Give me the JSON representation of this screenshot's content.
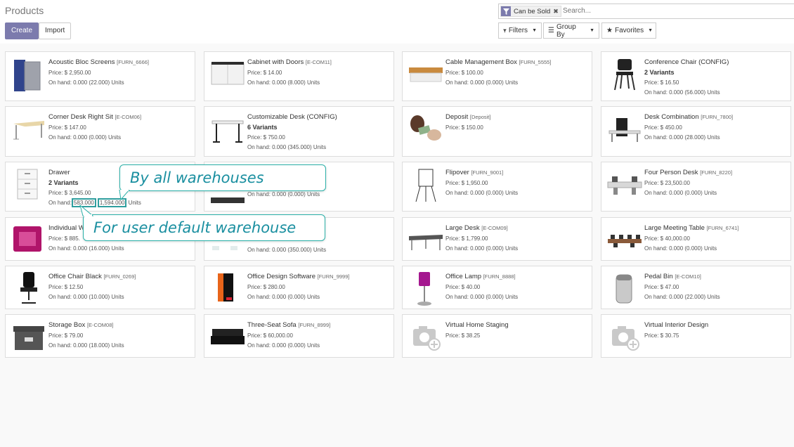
{
  "header": {
    "title": "Products",
    "create_label": "Create",
    "import_label": "Import"
  },
  "search": {
    "facet_value": "Can be Sold",
    "placeholder": "Search...",
    "filters_label": "Filters",
    "groupby_label": "Group By",
    "favorites_label": "Favorites"
  },
  "products": [
    {
      "name": "Acoustic Bloc Screens",
      "ref": "[FURN_6666]",
      "variants": "",
      "price": "Price: $ 2,950.00",
      "onhand": "On hand: 0.000 (22.000) Units",
      "icon": "acoustic-screen-icon"
    },
    {
      "name": "Cabinet with Doors",
      "ref": "[E-COM11]",
      "variants": "",
      "price": "Price: $ 14.00",
      "onhand": "On hand: 0.000 (8.000) Units",
      "icon": "cabinet-icon"
    },
    {
      "name": "Cable Management Box",
      "ref": "[FURN_5555]",
      "variants": "",
      "price": "Price: $ 100.00",
      "onhand": "On hand: 0.000 (0.000) Units",
      "icon": "cable-box-icon"
    },
    {
      "name": "Conference Chair (CONFIG)",
      "ref": "",
      "variants": "2 Variants",
      "price": "Price: $ 16.50",
      "onhand": "On hand: 0.000 (56.000) Units",
      "icon": "chair-icon"
    },
    {
      "name": "Corner Desk Right Sit",
      "ref": "[E-COM06]",
      "variants": "",
      "price": "Price: $ 147.00",
      "onhand": "On hand: 0.000 (0.000) Units",
      "icon": "corner-desk-icon"
    },
    {
      "name": "Customizable Desk (CONFIG)",
      "ref": "",
      "variants": "6 Variants",
      "price": "Price: $ 750.00",
      "onhand": "On hand: 0.000 (345.000) Units",
      "icon": "desk-icon"
    },
    {
      "name": "Deposit",
      "ref": "[Deposit]",
      "variants": "",
      "price": "Price: $ 150.00",
      "onhand": "",
      "icon": "money-icon"
    },
    {
      "name": "Desk Combination",
      "ref": "[FURN_7800]",
      "variants": "",
      "price": "Price: $ 450.00",
      "onhand": "On hand: 0.000 (28.000) Units",
      "icon": "desk-combination-icon"
    },
    {
      "name": "Drawer",
      "ref": "",
      "variants": "2 Variants",
      "price": "Price: $ 3,645.00",
      "onhand_prefix": "On hand:",
      "onhand_default": "583.000",
      "onhand_all": "1,594.000",
      "onhand_suffix": "Units",
      "icon": "drawer-icon"
    },
    {
      "name": "",
      "ref": "",
      "variants": "",
      "price": "",
      "onhand": "On hand: 0.000 (0.000) Units",
      "icon": "hidden-product-icon"
    },
    {
      "name": "Flipover",
      "ref": "[FURN_9001]",
      "variants": "",
      "price": "Price: $ 1,950.00",
      "onhand": "On hand: 0.000 (0.000) Units",
      "icon": "flipover-icon"
    },
    {
      "name": "Four Person Desk",
      "ref": "[FURN_8220]",
      "variants": "",
      "price": "Price: $ 23,500.00",
      "onhand": "On hand: 0.000 (0.000) Units",
      "icon": "four-person-desk-icon"
    },
    {
      "name": "Individual W",
      "ref": "",
      "variants": "",
      "price": "Price: $ 885.",
      "onhand": "On hand: 0.000 (16.000) Units",
      "icon": "workspace-icon"
    },
    {
      "name": "",
      "ref": "",
      "variants": "",
      "price": "",
      "onhand": "On hand: 0.000 (350.000) Units",
      "icon": "hidden-product-icon"
    },
    {
      "name": "Large Desk",
      "ref": "[E-COM09]",
      "variants": "",
      "price": "Price: $ 1,799.00",
      "onhand": "On hand: 0.000 (0.000) Units",
      "icon": "large-desk-icon"
    },
    {
      "name": "Large Meeting Table",
      "ref": "[FURN_6741]",
      "variants": "",
      "price": "Price: $ 40,000.00",
      "onhand": "On hand: 0.000 (0.000) Units",
      "icon": "meeting-table-icon"
    },
    {
      "name": "Office Chair Black",
      "ref": "[FURN_0269]",
      "variants": "",
      "price": "Price: $ 12.50",
      "onhand": "On hand: 0.000 (10.000) Units",
      "icon": "office-chair-icon"
    },
    {
      "name": "Office Design Software",
      "ref": "[FURN_9999]",
      "variants": "",
      "price": "Price: $ 280.00",
      "onhand": "On hand: 0.000 (0.000) Units",
      "icon": "software-box-icon"
    },
    {
      "name": "Office Lamp",
      "ref": "[FURN_8888]",
      "variants": "",
      "price": "Price: $ 40.00",
      "onhand": "On hand: 0.000 (0.000) Units",
      "icon": "lamp-icon"
    },
    {
      "name": "Pedal Bin",
      "ref": "[E-COM10]",
      "variants": "",
      "price": "Price: $ 47.00",
      "onhand": "On hand: 0.000 (22.000) Units",
      "icon": "bin-icon"
    },
    {
      "name": "Storage Box",
      "ref": "[E-COM08]",
      "variants": "",
      "price": "Price: $ 79.00",
      "onhand": "On hand: 0.000 (18.000) Units",
      "icon": "storage-box-icon"
    },
    {
      "name": "Three-Seat Sofa",
      "ref": "[FURN_8999]",
      "variants": "",
      "price": "Price: $ 60,000.00",
      "onhand": "On hand: 0.000 (0.000) Units",
      "icon": "sofa-icon"
    },
    {
      "name": "Virtual Home Staging",
      "ref": "",
      "variants": "",
      "price": "Price: $ 38.25",
      "onhand": "",
      "icon": "camera-placeholder-icon"
    },
    {
      "name": "Virtual Interior Design",
      "ref": "",
      "variants": "",
      "price": "Price: $ 30.75",
      "onhand": "",
      "icon": "camera-placeholder-icon"
    }
  ],
  "callouts": {
    "all_warehouses": "By all warehouses",
    "default_warehouse": "For user default warehouse"
  },
  "colors": {
    "primary": "#7c7bad",
    "highlight": "#2f9e9e",
    "callout_text": "#1a8fa0"
  }
}
